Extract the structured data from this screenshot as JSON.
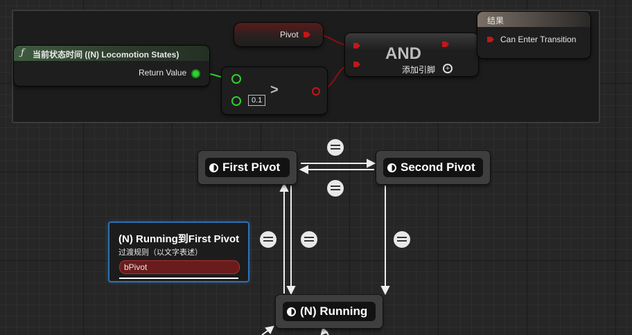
{
  "blueprint": {
    "function_node": {
      "icon": "function-icon",
      "title": "当前状态时间 ((N) Locomotion States)",
      "output_label": "Return Value"
    },
    "pivot_node": {
      "label": "Pivot"
    },
    "compare_node": {
      "operator": ">",
      "input_value": "0.1"
    },
    "and_node": {
      "title": "AND",
      "add_pin_label": "添加引脚",
      "add_pin_icon": "plus-icon"
    },
    "result_node": {
      "title": "结果",
      "input_label": "Can Enter Transition"
    }
  },
  "state_machine": {
    "states": {
      "first_pivot": "First Pivot",
      "second_pivot": "Second Pivot",
      "running": "(N) Running"
    },
    "tooltip": {
      "title": "(N) Running到First Pivot",
      "subtitle": "过渡规则（以文字表述）",
      "variable": "bPivot"
    }
  },
  "colors": {
    "bool_pin": "#c21818",
    "float_pin": "#2fd12f",
    "tooltip_border": "#2f6fb0"
  }
}
